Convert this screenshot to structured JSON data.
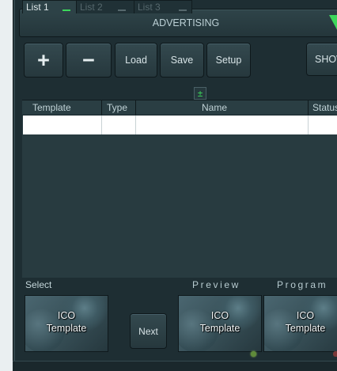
{
  "header": {
    "title": "ADVERTISING"
  },
  "toolbar": {
    "add_label": "+",
    "remove_label": "−",
    "load_label": "Load",
    "save_label": "Save",
    "setup_label": "Setup",
    "show_label": "SHOW"
  },
  "tabs": [
    {
      "label": "List 1",
      "active": true
    },
    {
      "label": "List 2",
      "active": false
    },
    {
      "label": "List 3",
      "active": false
    }
  ],
  "add_tab_label": "±",
  "table": {
    "columns": [
      "Template",
      "Type",
      "Name",
      "Status"
    ],
    "rows": [
      {
        "template": "",
        "type": "",
        "name": "",
        "status": ""
      }
    ]
  },
  "bottom": {
    "select_label": "Select",
    "preview_label": "Preview",
    "program_label": "Program",
    "next_label": "Next",
    "thumbs": [
      {
        "line1": "ICO",
        "line2": "Template"
      },
      {
        "line1": "ICO",
        "line2": "Template"
      },
      {
        "line1": "ICO",
        "line2": "Template"
      }
    ]
  },
  "colors": {
    "accent_green": "#3cd85b",
    "panel": "#1e2e33",
    "grid_bg": "#283b40",
    "indicator_on": "#5f8b3a",
    "indicator_red": "#7a3838"
  },
  "icons": [
    "down-triangle-icon",
    "plus-icon",
    "minus-icon",
    "add-list-icon"
  ]
}
